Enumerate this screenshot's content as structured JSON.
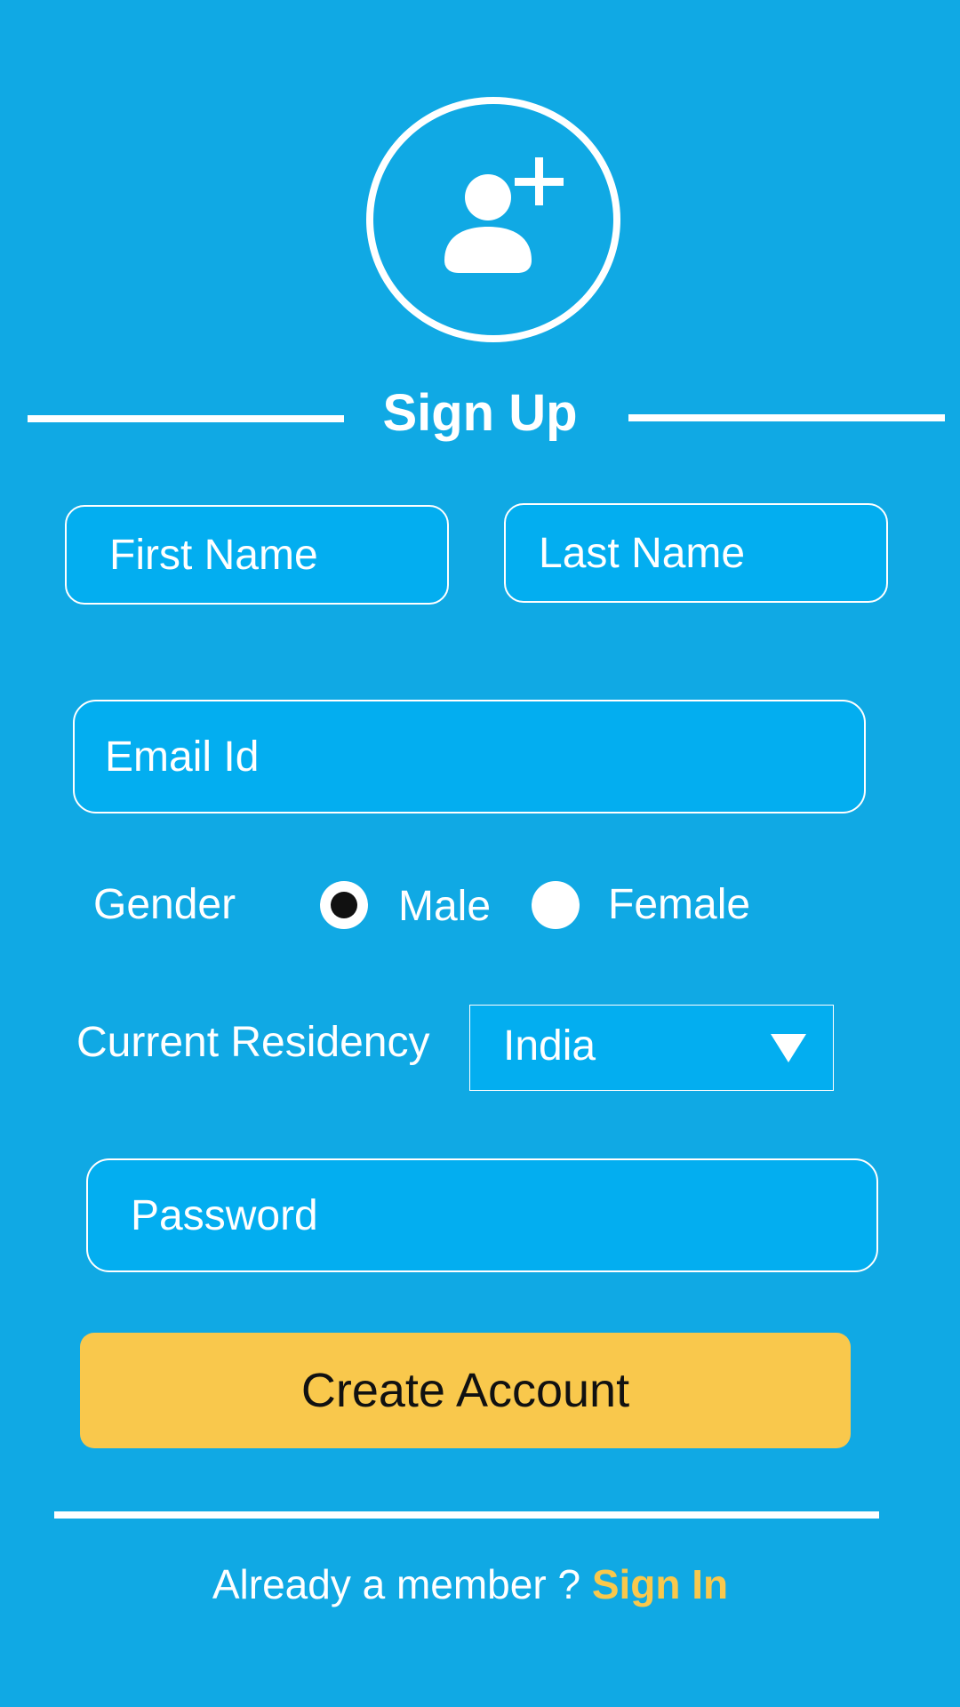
{
  "header": {
    "title": "Sign Up",
    "avatar_icon": "add-user-icon"
  },
  "form": {
    "first_name": {
      "placeholder": "First Name"
    },
    "last_name": {
      "placeholder": "Last Name"
    },
    "email": {
      "placeholder": "Email Id"
    },
    "gender": {
      "label": "Gender",
      "options": [
        {
          "label": "Male",
          "selected": true
        },
        {
          "label": "Female",
          "selected": false
        }
      ]
    },
    "residency": {
      "label": "Current Residency",
      "selected": "India"
    },
    "password": {
      "placeholder": "Password"
    },
    "submit_label": "Create Account"
  },
  "footer": {
    "prompt": "Already a member ?",
    "link_label": "Sign In"
  },
  "colors": {
    "background": "#10a9e4",
    "field_fill": "#03aef0",
    "accent": "#f9c84c",
    "text": "#ffffff"
  }
}
